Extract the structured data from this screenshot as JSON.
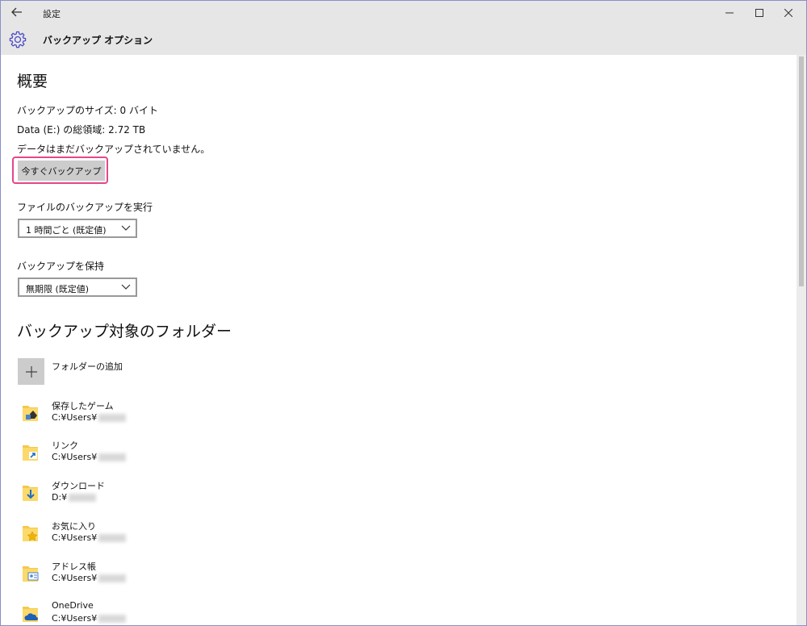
{
  "window": {
    "title": "設定"
  },
  "header": {
    "title": "バックアップ オプション"
  },
  "overview": {
    "heading": "概要",
    "backup_size": "バックアップのサイズ: 0 バイト",
    "total_space": "Data (E:) の総領域: 2.72 TB",
    "status": "データはまだバックアップされていません。",
    "backup_now_label": "今すぐバックアップ"
  },
  "frequency": {
    "label": "ファイルのバックアップを実行",
    "selected": "1 時間ごと (既定値)"
  },
  "retention": {
    "label": "バックアップを保持",
    "selected": "無期限 (既定値)"
  },
  "folders": {
    "heading": "バックアップ対象のフォルダー",
    "add_label": "フォルダーの追加",
    "items": [
      {
        "name": "保存したゲーム",
        "path": "C:¥Users¥",
        "icon": "saved-games-folder-icon"
      },
      {
        "name": "リンク",
        "path": "C:¥Users¥",
        "icon": "links-folder-icon"
      },
      {
        "name": "ダウンロード",
        "path": "D:¥",
        "icon": "downloads-folder-icon"
      },
      {
        "name": "お気に入り",
        "path": "C:¥Users¥",
        "icon": "favorites-folder-icon"
      },
      {
        "name": "アドレス帳",
        "path": "C:¥Users¥",
        "icon": "contacts-folder-icon"
      },
      {
        "name": "OneDrive",
        "path": "C:¥Users¥",
        "icon": "onedrive-folder-icon"
      }
    ]
  },
  "colors": {
    "chrome": "#e6e6e6",
    "accent": "#4c4ac5",
    "highlight": "#e5468c",
    "button": "#cccccc",
    "folder": "#f5c84c"
  }
}
